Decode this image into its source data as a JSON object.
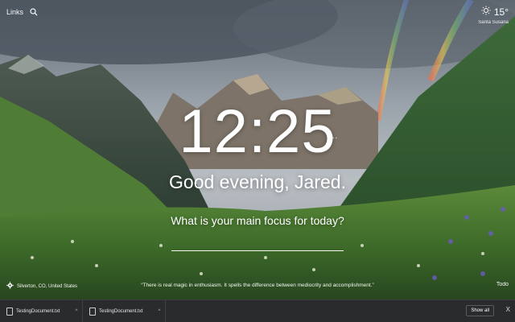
{
  "top": {
    "links_label": "Links",
    "search_icon": "search-icon"
  },
  "weather": {
    "icon": "sun-icon",
    "temperature": "15°",
    "location": "Santa Susana"
  },
  "clock": {
    "time": "12:25",
    "menu": "..."
  },
  "greeting": "Good evening, Jared.",
  "focus": {
    "question": "What is your main focus for today?",
    "value": "",
    "placeholder": ""
  },
  "bottom": {
    "settings_icon": "gear-icon",
    "location": "Silverton, CO, United States",
    "quote": "“There is real magic in enthusiasm. It spells the difference between mediocrity and accomplishment.”",
    "todo_label": "Todo"
  },
  "download_shelf": {
    "items": [
      {
        "name": "TestingDocument.txt",
        "icon": "document-icon"
      },
      {
        "name": "TestingDocument.txt",
        "icon": "document-icon"
      }
    ],
    "show_all_label": "Show all",
    "close_label": "X"
  },
  "colors": {
    "shelf": "#2a2b2d",
    "text": "#ffffff"
  }
}
